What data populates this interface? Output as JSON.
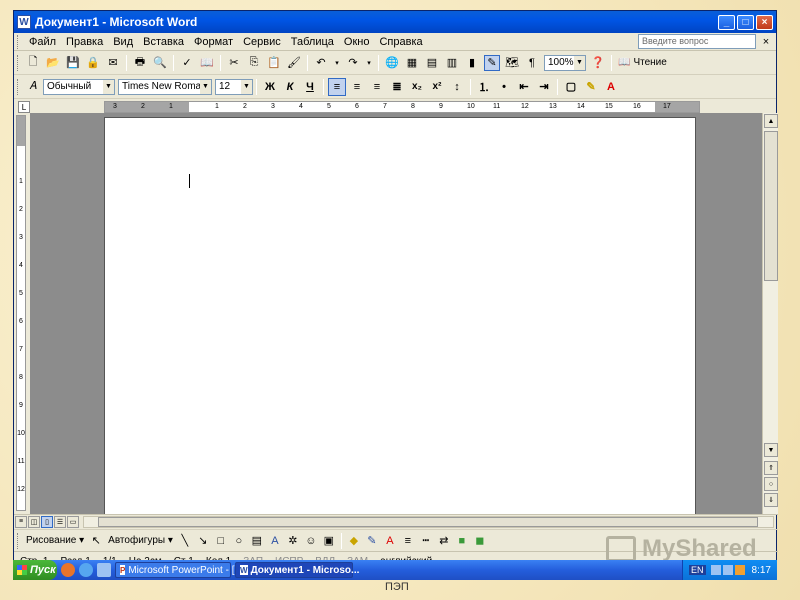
{
  "window": {
    "title": "Документ1 - Microsoft Word",
    "min": "_",
    "max": "□",
    "close": "×"
  },
  "menubar": {
    "items": [
      "Файл",
      "Правка",
      "Вид",
      "Вставка",
      "Формат",
      "Сервис",
      "Таблица",
      "Окно",
      "Справка"
    ],
    "ask_placeholder": "Введите вопрос",
    "close": "×"
  },
  "standard_toolbar": {
    "zoom": "100%",
    "reading_label": "Чтение"
  },
  "format_toolbar": {
    "style": "Обычный",
    "font": "Times New Roman",
    "size": "12",
    "bold": "Ж",
    "italic": "К",
    "underline": "Ч"
  },
  "ruler": {
    "corner": "L",
    "h_numbers": [
      "3",
      "2",
      "1",
      "1",
      "2",
      "3",
      "4",
      "5",
      "6",
      "7",
      "8",
      "9",
      "10",
      "11",
      "12",
      "13",
      "14",
      "15",
      "16",
      "17"
    ],
    "v_numbers": [
      "1",
      "2",
      "3",
      "4",
      "5",
      "6",
      "7",
      "8",
      "9",
      "10",
      "11",
      "12"
    ]
  },
  "drawing_toolbar": {
    "drawing_label": "Рисование ▾",
    "autoshapes_label": "Автофигуры ▾"
  },
  "statusbar": {
    "page": "Стр. 1",
    "section": "Разд 1",
    "pages": "1/1",
    "at": "На 2см",
    "line": "Ст 1",
    "col": "Кол 1",
    "rec": "ЗАП",
    "trk": "ИСПР",
    "ext": "ВДЛ",
    "ovr": "ЗАМ",
    "language": "английский"
  },
  "watermark": {
    "text": "MyShared"
  },
  "taskbar": {
    "start_label": "Пуск",
    "tasks": [
      {
        "label": "Microsoft PowerPoint - [..."
      },
      {
        "label": "Документ1 - Microso..."
      }
    ],
    "lang": "EN",
    "time": "8:17"
  },
  "footnote": {
    "text": "ПЭП"
  }
}
